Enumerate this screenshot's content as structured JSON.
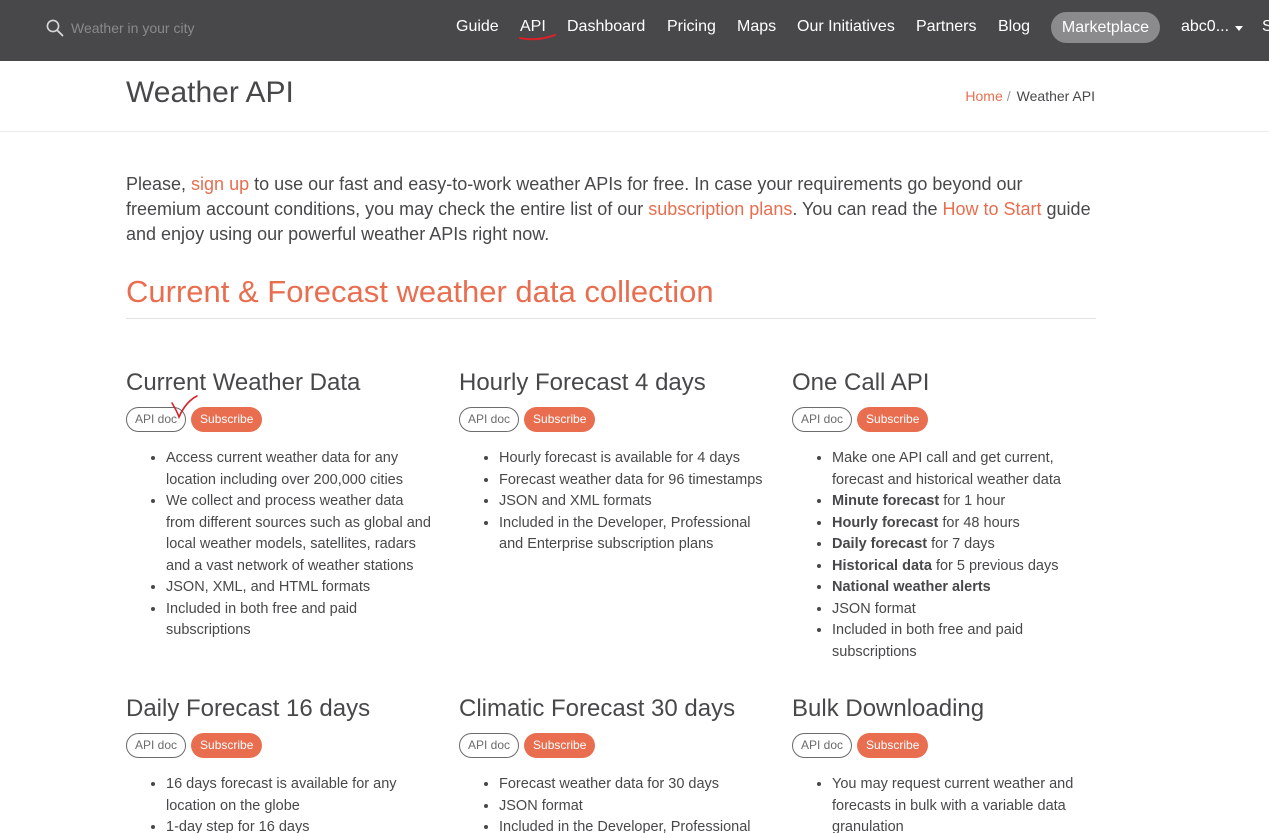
{
  "nav": {
    "search_placeholder": "Weather in your city",
    "items": [
      "Guide",
      "API",
      "Dashboard",
      "Pricing",
      "Maps",
      "Our Initiatives",
      "Partners",
      "Blog"
    ],
    "marketplace": "Marketplace",
    "user": "abc0...",
    "cut_item": "S"
  },
  "header": {
    "title": "Weather API",
    "breadcrumb_home": "Home",
    "breadcrumb_sep": "/",
    "breadcrumb_current": "Weather API"
  },
  "intro": {
    "p1": "Please, ",
    "link_signup": "sign up",
    "p2": " to use our fast and easy-to-work weather APIs for free. In case your requirements go beyond our freemium account conditions, you may check the entire list of our ",
    "link_plans": "subscription plans",
    "p3": ". You can read the ",
    "link_start": "How to Start",
    "p4": " guide and enjoy using our powerful weather APIs right now."
  },
  "section_title": "Current & Forecast weather data collection",
  "buttons": {
    "doc": "API doc",
    "subscribe": "Subscribe"
  },
  "cards": [
    {
      "title": "Current Weather Data",
      "items": [
        {
          "b": "",
          "t": "Access current weather data for any location including over 200,000 cities"
        },
        {
          "b": "",
          "t": "We collect and process weather data from different sources such as global and local weather models, satellites, radars and a vast network of weather stations"
        },
        {
          "b": "",
          "t": "JSON, XML, and HTML formats"
        },
        {
          "b": "",
          "t": "Included in both free and paid subscriptions"
        }
      ]
    },
    {
      "title": "Hourly Forecast 4 days",
      "items": [
        {
          "b": "",
          "t": "Hourly forecast is available for 4 days"
        },
        {
          "b": "",
          "t": "Forecast weather data for 96 timestamps"
        },
        {
          "b": "",
          "t": "JSON and XML formats"
        },
        {
          "b": "",
          "t": "Included in the Developer, Professional and Enterprise subscription plans"
        }
      ]
    },
    {
      "title": "One Call API",
      "items": [
        {
          "b": "",
          "t": "Make one API call and get current, forecast and historical weather data"
        },
        {
          "b": "Minute forecast",
          "t": " for 1 hour"
        },
        {
          "b": "Hourly forecast",
          "t": " for 48 hours"
        },
        {
          "b": "Daily forecast",
          "t": " for 7 days"
        },
        {
          "b": "Historical data",
          "t": " for 5 previous days"
        },
        {
          "b": "National weather alerts",
          "t": ""
        },
        {
          "b": "",
          "t": "JSON format"
        },
        {
          "b": "",
          "t": "Included in both free and paid subscriptions"
        }
      ]
    },
    {
      "title": "Daily Forecast 16 days",
      "items": [
        {
          "b": "",
          "t": "16 days forecast is available for any location on the globe"
        },
        {
          "b": "",
          "t": "1-day step for 16 days"
        }
      ]
    },
    {
      "title": "Climatic Forecast 30 days",
      "items": [
        {
          "b": "",
          "t": "Forecast weather data for 30 days"
        },
        {
          "b": "",
          "t": "JSON format"
        },
        {
          "b": "",
          "t": "Included in the Developer, Professional"
        }
      ]
    },
    {
      "title": "Bulk Downloading",
      "items": [
        {
          "b": "",
          "t": "You may request current weather and forecasts in bulk with a variable data granulation"
        }
      ]
    }
  ],
  "colors": {
    "nav_bg": "#48484a",
    "accent": "#e96e50",
    "marketplace_bg": "#8b8b8d",
    "annotation": "#d6222a"
  }
}
